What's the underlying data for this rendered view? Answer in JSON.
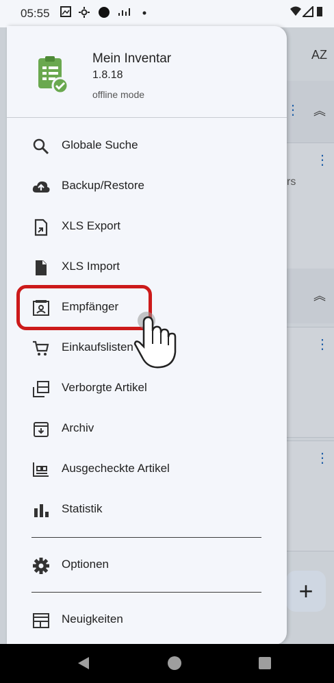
{
  "status_bar": {
    "time": "05:55",
    "icons": [
      "photo-icon",
      "settings-icon",
      "dot-icon",
      "signal-icon",
      "more-dot-icon"
    ],
    "right_icons": [
      "wifi-icon",
      "cell-icon",
      "battery-icon"
    ]
  },
  "background": {
    "sort_label": "AZ",
    "plus_label": "+",
    "partial_text": "rs"
  },
  "drawer": {
    "app_name": "Mein Inventar",
    "version": "1.8.18",
    "mode": "offline mode",
    "items": [
      {
        "label": "Globale Suche",
        "icon": "search-icon"
      },
      {
        "label": "Backup/Restore",
        "icon": "cloud-upload-icon"
      },
      {
        "label": "XLS Export",
        "icon": "file-export-icon"
      },
      {
        "label": "XLS Import",
        "icon": "file-icon"
      },
      {
        "label": "Empfänger",
        "icon": "contact-card-icon"
      },
      {
        "label": "Einkaufslisten",
        "icon": "cart-icon"
      },
      {
        "label": "Verborgte Artikel",
        "icon": "hidden-items-icon"
      },
      {
        "label": "Archiv",
        "icon": "archive-icon"
      },
      {
        "label": "Ausgecheckte Artikel",
        "icon": "checkout-icon"
      },
      {
        "label": "Statistik",
        "icon": "bar-chart-icon"
      },
      {
        "label": "Optionen",
        "icon": "gear-icon"
      },
      {
        "label": "Neuigkeiten",
        "icon": "news-icon"
      }
    ]
  },
  "colors": {
    "highlight": "#cc1a1a",
    "app_icon_green": "#6aa84f"
  }
}
